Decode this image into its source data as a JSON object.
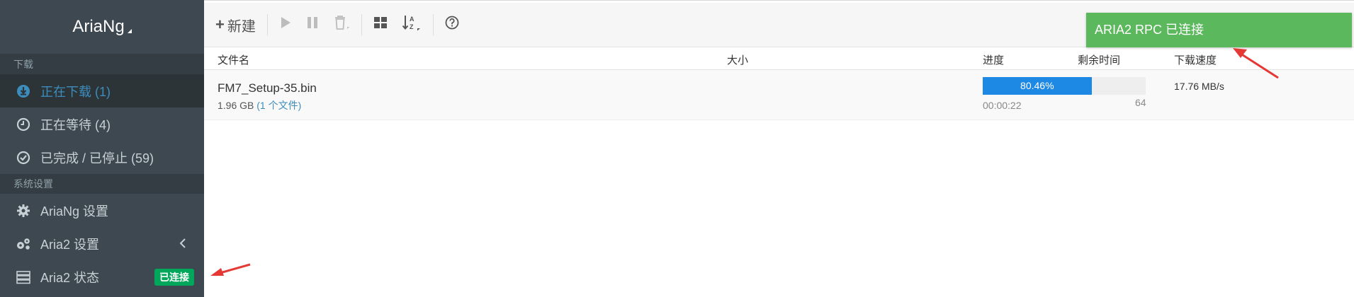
{
  "app": {
    "title": "AriaNg"
  },
  "sidebar": {
    "section_download": "下载",
    "items": [
      {
        "label": "正在下载 (1)",
        "icon": "download-circle-icon"
      },
      {
        "label": "正在等待 (4)",
        "icon": "clock-icon"
      },
      {
        "label": "已完成 / 已停止 (59)",
        "icon": "check-circle-icon"
      }
    ],
    "section_settings": "系统设置",
    "settings": [
      {
        "label": "AriaNg 设置",
        "icon": "gear-icon"
      },
      {
        "label": "Aria2 设置",
        "icon": "gears-icon"
      },
      {
        "label": "Aria2 状态",
        "icon": "server-icon",
        "badge": "已连接"
      }
    ]
  },
  "toolbar": {
    "new_label": "新建"
  },
  "table": {
    "headers": {
      "name": "文件名",
      "size": "大小",
      "progress": "进度",
      "remaining": "剩余时间",
      "speed": "下载速度"
    },
    "rows": [
      {
        "name": "FM7_Setup-35.bin",
        "size": "1.96 GB",
        "files": "(1 个文件)",
        "progress_text": "80.46%",
        "progress": 80.46,
        "remaining": "00:00:22",
        "connections": "64",
        "speed": "17.76 MB/s"
      }
    ]
  },
  "notification": {
    "text": "ARIA2 RPC 已连接"
  },
  "colors": {
    "sidebar_bg": "#3d4850",
    "accent": "#1e88e5",
    "success": "#5cb85c",
    "badge": "#00a65a",
    "annotation": "#e53935"
  }
}
